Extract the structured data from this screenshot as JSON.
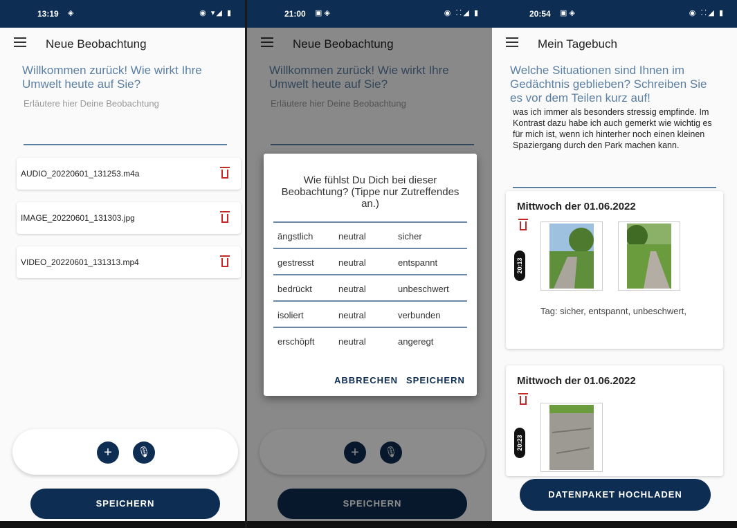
{
  "screen1": {
    "time": "13:19",
    "title": "Neue Beobachtung",
    "prompt": "Willkommen zurück! Wie wirkt Ihre Umwelt heute auf Sie?",
    "placeholder": "Erläutere hier Deine Beobachtung",
    "files": [
      "AUDIO_20220601_131253.m4a",
      "IMAGE_20220601_131303.jpg",
      "VIDEO_20220601_131313.mp4"
    ],
    "save_label": "SPEICHERN"
  },
  "screen2": {
    "time": "21:00",
    "title": "Neue Beobachtung",
    "prompt": "Willkommen zurück! Wie wirkt Ihre Umwelt heute auf Sie?",
    "placeholder": "Erläutere hier Deine Beobachtung",
    "save_label": "SPEICHERN",
    "dialog": {
      "question": "Wie fühlst Du Dich bei dieser Beobachtung? (Tippe nur Zutreffendes an.)",
      "rows": [
        [
          "ängstlich",
          "neutral",
          "sicher"
        ],
        [
          "gestresst",
          "neutral",
          "entspannt"
        ],
        [
          "bedrückt",
          "neutral",
          "unbeschwert"
        ],
        [
          "isoliert",
          "neutral",
          "verbunden"
        ],
        [
          "erschöpft",
          "neutral",
          "angeregt"
        ]
      ],
      "cancel": "ABBRECHEN",
      "save": "SPEICHERN"
    }
  },
  "screen3": {
    "time": "20:54",
    "title": "Mein Tagebuch",
    "prompt": "Welche Situationen sind Ihnen im Gedächtnis geblieben? Schreiben Sie es vor dem Teilen kurz auf!",
    "journal_text": "was ich immer als besonders stressig empfinde. Im Kontrast dazu habe ich auch gemerkt wie wichtig es für mich ist, wenn ich hinterher noch einen kleinen Spaziergang durch den Park machen kann.",
    "entries": [
      {
        "date": "Mittwoch der 01.06.2022",
        "time": "20:13 UHR",
        "tags": "Tag: sicher, entspannt, unbeschwert,"
      },
      {
        "date": "Mittwoch der 01.06.2022",
        "time": "20:23 UHR",
        "tags": ""
      }
    ],
    "upload_label": "DATENPAKET HOCHLADEN"
  },
  "colors": {
    "primary": "#0d2d52",
    "accent": "#5b7fa3",
    "danger": "#c62828"
  },
  "icons": [
    "menu-icon",
    "trash-icon",
    "plus-icon",
    "mic-icon",
    "location-icon",
    "wifi-icon",
    "battery-icon"
  ]
}
